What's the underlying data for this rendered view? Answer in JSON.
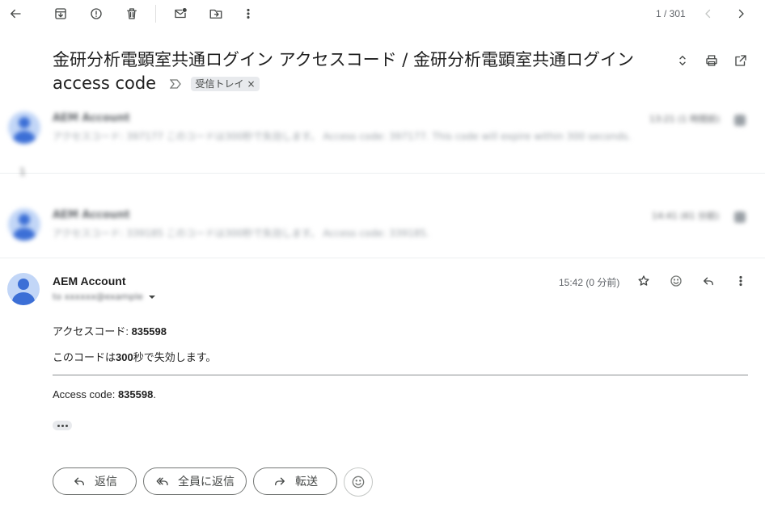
{
  "toolbar": {
    "pagination": "1 / 301"
  },
  "thread": {
    "subject": "金研分析電顕室共通ログイン アクセスコード / 金研分析電顕室共通ログイン access code",
    "label": "受信トレイ",
    "label_remove": "×"
  },
  "collapsed": [
    {
      "sender": "AEM Account",
      "snippet": "アクセスコード: 397177 このコードは300秒で失効します。 Access code: 397177. This code will expire within 300 seconds.",
      "time": "13:21 (1 時間前)"
    },
    {
      "sender": "AEM Account",
      "snippet": "アクセスコード: 339185 このコードは300秒で失効します。 Access code: 339185.",
      "time": "14:41 (61 分前)"
    }
  ],
  "hidden_count_marker": "1",
  "message": {
    "sender": "AEM Account",
    "recipient": "to xxxxxx@example",
    "time": "15:42 (0 分前)",
    "line1_prefix": "アクセスコード: ",
    "line1_code": "835598",
    "line2_prefix": "このコードは",
    "line2_seconds": "300",
    "line2_suffix": "秒で失効します。",
    "line3_prefix": "Access code: ",
    "line3_code": "835598",
    "line3_suffix": "."
  },
  "actions": {
    "reply": "返信",
    "reply_all": "全員に返信",
    "forward": "転送"
  },
  "icons": [
    "back-arrow-icon",
    "archive-icon",
    "spam-icon",
    "delete-icon",
    "mark-unread-icon",
    "move-to-icon",
    "more-vert-icon",
    "chevron-left-icon",
    "chevron-right-icon",
    "expand-collapse-icon",
    "print-icon",
    "open-new-window-icon",
    "star-icon",
    "emoji-icon",
    "reply-icon",
    "reply-all-icon",
    "forward-icon"
  ],
  "colors": {
    "avatar_bg": "#c2d6f7",
    "avatar_fg": "#3c6fd6",
    "chip_bg": "#e8eaed"
  }
}
